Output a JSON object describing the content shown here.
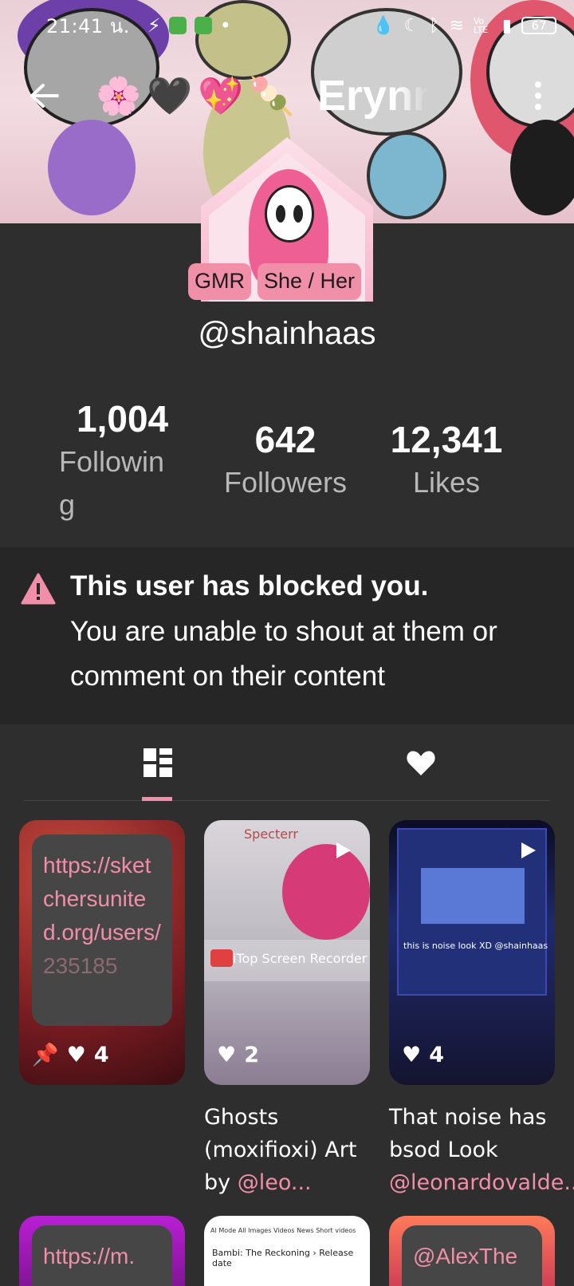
{
  "status_bar": {
    "time": "21:41",
    "suffix": "น.",
    "battery": "67",
    "signal": "Vo LTE"
  },
  "header": {
    "name": "Erynn",
    "emojis": [
      "🌸",
      "🖤",
      "💖",
      "🍡"
    ]
  },
  "profile": {
    "badges": [
      "GMR",
      "She / Her"
    ],
    "username": "@shainhaas",
    "stats": {
      "following": {
        "value": "1,004",
        "label": "Following"
      },
      "followers": {
        "value": "642",
        "label": "Followers"
      },
      "likes": {
        "value": "12,341",
        "label": "Likes"
      }
    }
  },
  "blocked_notice": {
    "title": "This user has blocked you.",
    "text": "You are unable to shout at them or comment on their content"
  },
  "posts": [
    {
      "link_main": "https://sketchersunited.org/users/",
      "link_faded": "235185",
      "likes": "4",
      "pinned": true
    },
    {
      "mock_title": "Specterr",
      "overlay": "iTop Screen Recorder",
      "likes": "2",
      "caption": "Ghosts (moxifioxi) Art by ",
      "mention": "@leo..."
    },
    {
      "mock_text": "this is noise look XD @shainhaas",
      "likes": "4",
      "caption": "That noise has bsod Look ",
      "mention": "@leonardovalde..."
    }
  ],
  "posts_row2": [
    {
      "link": "https://m."
    },
    {
      "search_tabs": "AI Mode  All  Images  Videos  News  Short videos",
      "result_title": "Bambi: The Reckoning › Release date"
    },
    {
      "link": "@AlexThe"
    }
  ],
  "colors": {
    "accent": "#f28fa8",
    "background": "#2e2e2e",
    "notice_bg": "#262626"
  }
}
